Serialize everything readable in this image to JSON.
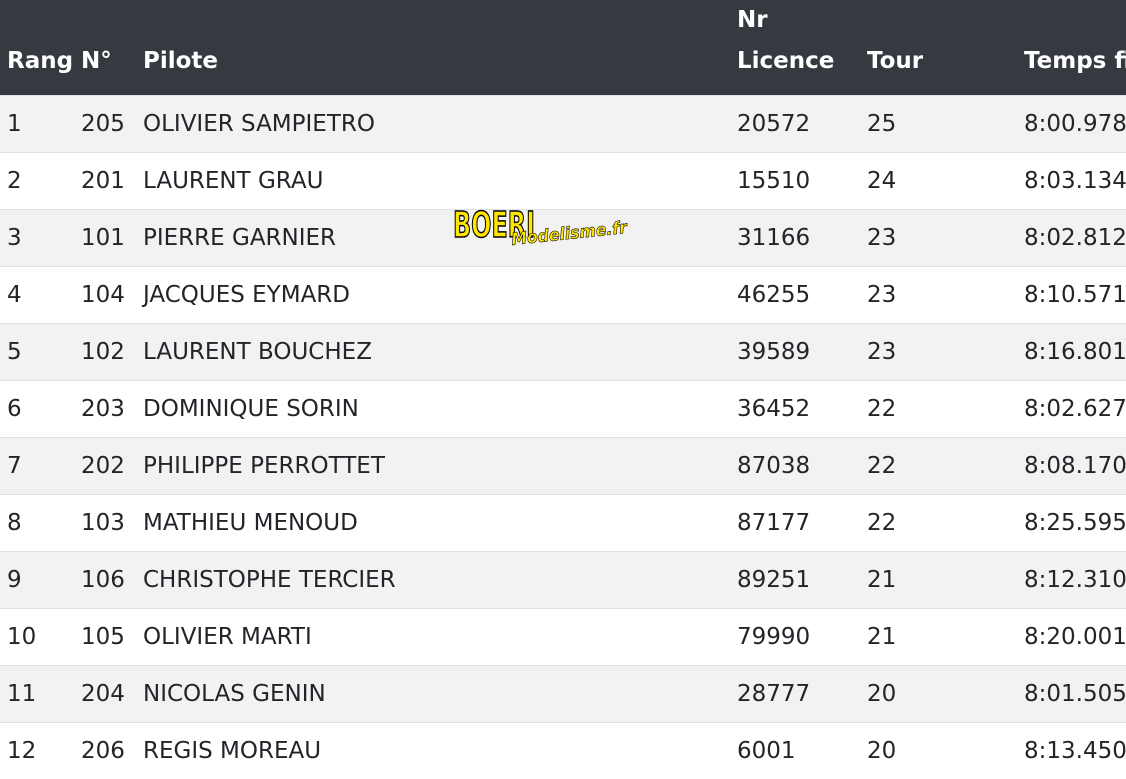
{
  "columns": {
    "rang": "Rang",
    "num": "N°",
    "pilote": "Pilote",
    "licence_line1": "Nr",
    "licence_line2": "Licence",
    "tour": "Tour",
    "temps": "Temps fi"
  },
  "rows": [
    {
      "rang": "1",
      "num": "205",
      "pilote": "OLIVIER SAMPIETRO",
      "licence": "20572",
      "tour": "25",
      "temps": "8:00.978"
    },
    {
      "rang": "2",
      "num": "201",
      "pilote": "LAURENT GRAU",
      "licence": "15510",
      "tour": "24",
      "temps": "8:03.134"
    },
    {
      "rang": "3",
      "num": "101",
      "pilote": "PIERRE GARNIER",
      "licence": "31166",
      "tour": "23",
      "temps": "8:02.812"
    },
    {
      "rang": "4",
      "num": "104",
      "pilote": "JACQUES EYMARD",
      "licence": "46255",
      "tour": "23",
      "temps": "8:10.571"
    },
    {
      "rang": "5",
      "num": "102",
      "pilote": "LAURENT BOUCHEZ",
      "licence": "39589",
      "tour": "23",
      "temps": "8:16.801"
    },
    {
      "rang": "6",
      "num": "203",
      "pilote": "DOMINIQUE SORIN",
      "licence": "36452",
      "tour": "22",
      "temps": "8:02.627"
    },
    {
      "rang": "7",
      "num": "202",
      "pilote": "PHILIPPE PERROTTET",
      "licence": "87038",
      "tour": "22",
      "temps": "8:08.170"
    },
    {
      "rang": "8",
      "num": "103",
      "pilote": "MATHIEU MENOUD",
      "licence": "87177",
      "tour": "22",
      "temps": "8:25.595"
    },
    {
      "rang": "9",
      "num": "106",
      "pilote": "CHRISTOPHE TERCIER",
      "licence": "89251",
      "tour": "21",
      "temps": "8:12.310"
    },
    {
      "rang": "10",
      "num": "105",
      "pilote": "OLIVIER MARTI",
      "licence": "79990",
      "tour": "21",
      "temps": "8:20.001"
    },
    {
      "rang": "11",
      "num": "204",
      "pilote": "NICOLAS GENIN",
      "licence": "28777",
      "tour": "20",
      "temps": "8:01.505"
    },
    {
      "rang": "12",
      "num": "206",
      "pilote": "REGIS MOREAU",
      "licence": "6001",
      "tour": "20",
      "temps": "8:13.450"
    }
  ],
  "watermark": {
    "main": "BOERI",
    "sub": "Modelisme.fr",
    "yellow": "#ffe600",
    "red": "#d01010"
  },
  "colors": {
    "header_bg": "#343a40",
    "stripe": "#f2f2f2"
  }
}
